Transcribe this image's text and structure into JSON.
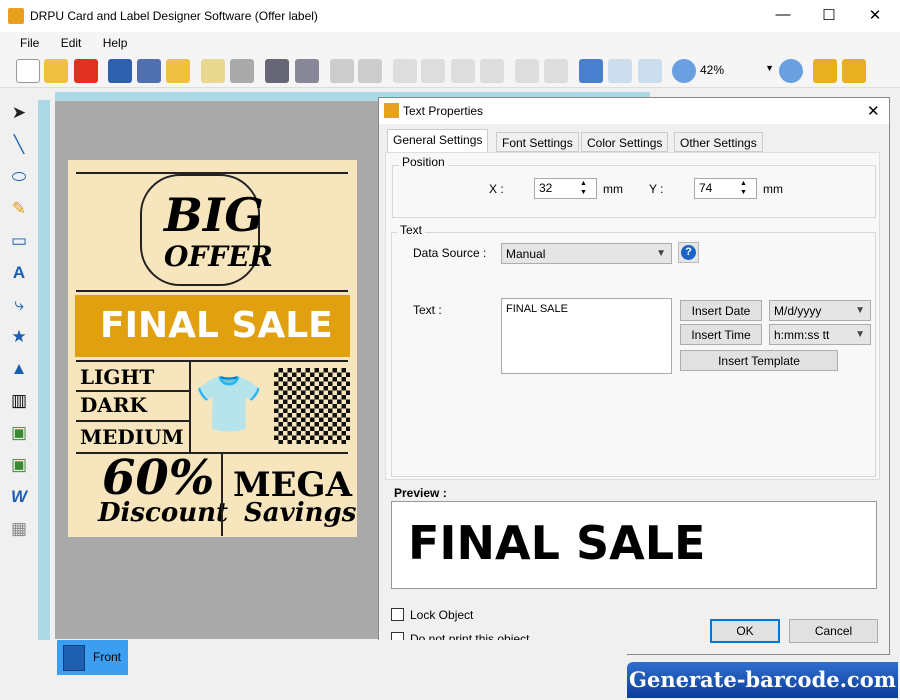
{
  "window": {
    "title": "DRPU Card and Label Designer Software (Offer label)",
    "minimize": "—",
    "maximize": "☐",
    "close": "✕"
  },
  "menu": [
    "File",
    "Edit",
    "Help"
  ],
  "toolbar": {
    "zoom": "42%"
  },
  "label": {
    "big": "BIG",
    "offer": "OFFER",
    "final_sale": "FINAL SALE",
    "light": "LIGHT",
    "dark": "DARK",
    "medium": "MEDIUM",
    "percent": "60%",
    "discount": "Discount",
    "mega": "MEGA",
    "savings": "Savings"
  },
  "dialog": {
    "title": "Text Properties",
    "close": "✕",
    "tabs": [
      "General Settings",
      "Font Settings",
      "Color Settings",
      "Other Settings"
    ],
    "position": {
      "label": "Position",
      "x_label": "X :",
      "x": "32",
      "y_label": "Y :",
      "y": "74",
      "unit": "mm"
    },
    "text_group": {
      "label": "Text",
      "data_source_label": "Data Source :",
      "data_source": "Manual",
      "text_label": "Text :",
      "text": "FINAL SALE",
      "insert_date": "Insert Date",
      "date_format": "M/d/yyyy",
      "insert_time": "Insert Time",
      "time_format": "h:mm:ss tt",
      "insert_template": "Insert Template"
    },
    "preview_label": "Preview :",
    "preview_text": "FINAL SALE",
    "lock_object": "Lock Object",
    "do_not_print": "Do not print this object",
    "ok": "OK",
    "cancel": "Cancel"
  },
  "footer": {
    "front_tab": "Front"
  },
  "watermark": "Generate-barcode.com"
}
